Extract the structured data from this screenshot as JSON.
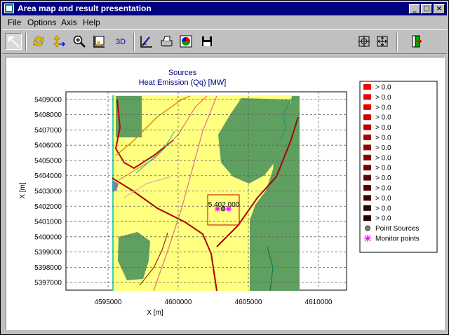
{
  "window": {
    "title": "Area map and result presentation",
    "min": "_",
    "max": "□",
    "close": "×"
  },
  "menu": [
    {
      "label": "File"
    },
    {
      "label": "Options"
    },
    {
      "label": "Axis"
    },
    {
      "label": "Help"
    }
  ],
  "toolbar": {
    "zoom_3d_label": "3D"
  },
  "chart_data": {
    "type": "map",
    "title": "Sources",
    "subtitle": "Heat Emission (Qq) [MW]",
    "xlabel": "X [m]",
    "ylabel": "X [m]",
    "xlim": [
      4592000,
      4612000
    ],
    "ylim": [
      5396500,
      5409500
    ],
    "xticks": [
      "4595000",
      "4600000",
      "4605000",
      "4610000"
    ],
    "yticks": [
      "5409000",
      "5408000",
      "5407000",
      "5406000",
      "5405000",
      "5404000",
      "5403000",
      "5402000",
      "5401000",
      "5400000",
      "5399000",
      "5398000",
      "5397000"
    ],
    "grid": true,
    "annotation": "5.402.000",
    "legend": {
      "placement": "right",
      "items": [
        {
          "label": "> 0.0",
          "color": "#ff0000"
        },
        {
          "label": "> 0.0",
          "color": "#ee0000"
        },
        {
          "label": "> 0.0",
          "color": "#dd0000"
        },
        {
          "label": "> 0.0",
          "color": "#cc0000"
        },
        {
          "label": "> 0.0",
          "color": "#bb0000"
        },
        {
          "label": "> 0.0",
          "color": "#aa0000"
        },
        {
          "label": "> 0.0",
          "color": "#990000"
        },
        {
          "label": "> 0.0",
          "color": "#880000"
        },
        {
          "label": "> 0.0",
          "color": "#770000"
        },
        {
          "label": "> 0.0",
          "color": "#660000"
        },
        {
          "label": "> 0.0",
          "color": "#550000"
        },
        {
          "label": "> 0.0",
          "color": "#440000"
        },
        {
          "label": "> 0.0",
          "color": "#330000"
        },
        {
          "label": "> 0.0",
          "color": "#220000"
        },
        {
          "label": "Point Sources",
          "color": "#808080"
        },
        {
          "label": "Monitor points",
          "color": "#ff00ff"
        }
      ]
    }
  }
}
